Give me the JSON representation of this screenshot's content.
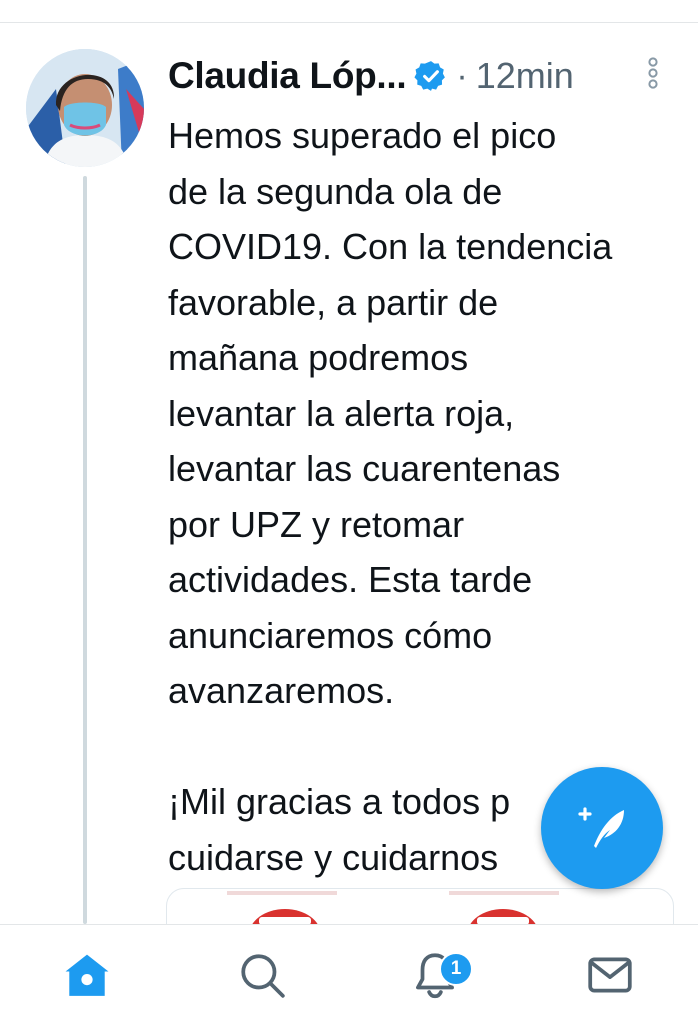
{
  "tweet": {
    "author_name": "Claudia Lóp...",
    "verified": true,
    "separator": "·",
    "timestamp": "12min",
    "body_lines": [
      "Hemos superado el pico",
      "de la segunda ola de",
      "COVID19. Con la tendencia",
      "favorable, a partir de",
      "mañana podremos",
      "levantar la alerta roja,",
      "levantar las cuarentenas",
      "por UPZ y retomar",
      "actividades. Esta tarde",
      "anunciaremos cómo",
      "avanzaremos."
    ],
    "body_lines_2": [
      "¡Mil gracias a todos p",
      "cuidarse y cuidarnos"
    ]
  },
  "icons": {
    "verified": "verified-badge-icon",
    "more": "more-vertical-icon",
    "compose": "compose-tweet-icon",
    "home": "home-icon",
    "search": "search-icon",
    "notifications": "bell-icon",
    "messages": "mail-icon"
  },
  "bottom_nav": {
    "notifications_badge": "1"
  },
  "colors": {
    "accent": "#1d9bf0",
    "text_primary": "#0f1419",
    "text_secondary": "#536471"
  }
}
